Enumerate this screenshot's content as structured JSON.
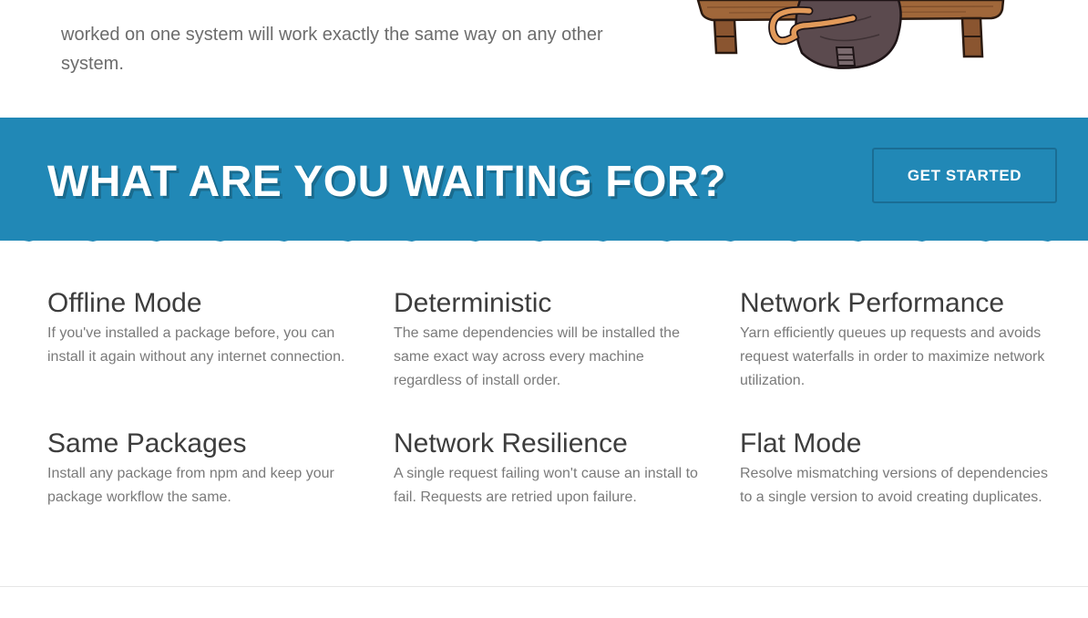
{
  "intro": {
    "text": "worked on one system will work exactly the same way on any other system."
  },
  "banner": {
    "title": "WHAT ARE YOU WAITING FOR?",
    "button_label": "GET STARTED",
    "background_color": "#2188b6"
  },
  "features": [
    {
      "title": "Offline Mode",
      "description": "If you've installed a package before, you can install it again without any internet connection."
    },
    {
      "title": "Deterministic",
      "description": "The same dependencies will be installed the same exact way across every machine regardless of install order."
    },
    {
      "title": "Network Performance",
      "description": "Yarn efficiently queues up requests and avoids request waterfalls in order to maximize network utilization."
    },
    {
      "title": "Same Packages",
      "description": "Install any package from npm and keep your package workflow the same."
    },
    {
      "title": "Network Resilience",
      "description": "A single request failing won't cause an install to fail. Requests are retried upon failure."
    },
    {
      "title": "Flat Mode",
      "description": "Resolve mismatching versions of dependencies to a single version to avoid creating duplicates."
    }
  ]
}
